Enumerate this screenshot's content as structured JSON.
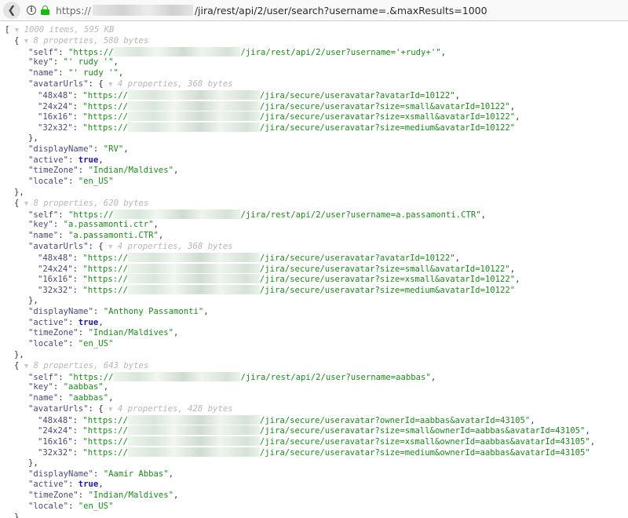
{
  "browser": {
    "url_prefix": "https://",
    "url_path": "/jira/rest/api/2/user/search?username=.&maxResults=1000"
  },
  "root": {
    "open": "[",
    "meta": "1000 items, 595 KB"
  },
  "users": [
    {
      "meta": "8 properties, 580 bytes",
      "self_prefix": "\"https://",
      "self_suffix": "/jira/rest/api/2/user?username='+rudy+'\"",
      "key": "\"' rudy '\"",
      "name": "\"' rudy '\"",
      "avatar_meta": "4 properties, 368 bytes",
      "avatars": [
        {
          "size": "\"48x48\"",
          "prefix": "\"https://",
          "suffix": "/jira/secure/useravatar?avatarId=10122\"",
          "comma": ","
        },
        {
          "size": "\"24x24\"",
          "prefix": "\"https://",
          "suffix": "/jira/secure/useravatar?size=small&avatarId=10122\"",
          "comma": ","
        },
        {
          "size": "\"16x16\"",
          "prefix": "\"https://",
          "suffix": "/jira/secure/useravatar?size=xsmall&avatarId=10122\"",
          "comma": ","
        },
        {
          "size": "\"32x32\"",
          "prefix": "\"https://",
          "suffix": "/jira/secure/useravatar?size=medium&avatarId=10122\"",
          "comma": ""
        }
      ],
      "displayName": "\"RV\"",
      "active": "true",
      "timeZone": "\"Indian/Maldives\"",
      "locale": "\"en_US\""
    },
    {
      "meta": "8 properties, 620 bytes",
      "self_prefix": "\"https://",
      "self_suffix": "/jira/rest/api/2/user?username=a.passamonti.CTR\"",
      "key": "\"a.passamonti.ctr\"",
      "name": "\"a.passamonti.CTR\"",
      "avatar_meta": "4 properties, 368 bytes",
      "avatars": [
        {
          "size": "\"48x48\"",
          "prefix": "\"https://",
          "suffix": "/jira/secure/useravatar?avatarId=10122\"",
          "comma": ","
        },
        {
          "size": "\"24x24\"",
          "prefix": "\"https://",
          "suffix": "/jira/secure/useravatar?size=small&avatarId=10122\"",
          "comma": ","
        },
        {
          "size": "\"16x16\"",
          "prefix": "\"https://",
          "suffix": "/jira/secure/useravatar?size=xsmall&avatarId=10122\"",
          "comma": ","
        },
        {
          "size": "\"32x32\"",
          "prefix": "\"https://",
          "suffix": "/jira/secure/useravatar?size=medium&avatarId=10122\"",
          "comma": ""
        }
      ],
      "displayName": "\"Anthony Passamonti\"",
      "active": "true",
      "timeZone": "\"Indian/Maldives\"",
      "locale": "\"en_US\""
    },
    {
      "meta": "8 properties, 643 bytes",
      "self_prefix": "\"https://",
      "self_suffix": "/jira/rest/api/2/user?username=aabbas\"",
      "key": "\"aabbas\"",
      "name": "\"aabbas\"",
      "avatar_meta": "4 properties, 428 bytes",
      "avatars": [
        {
          "size": "\"48x48\"",
          "prefix": "\"https://",
          "suffix": "/jira/secure/useravatar?ownerId=aabbas&avatarId=43105\"",
          "comma": ","
        },
        {
          "size": "\"24x24\"",
          "prefix": "\"https://",
          "suffix": "/jira/secure/useravatar?size=small&ownerId=aabbas&avatarId=43105\"",
          "comma": ","
        },
        {
          "size": "\"16x16\"",
          "prefix": "\"https://",
          "suffix": "/jira/secure/useravatar?size=xsmall&ownerId=aabbas&avatarId=43105\"",
          "comma": ","
        },
        {
          "size": "\"32x32\"",
          "prefix": "\"https://",
          "suffix": "/jira/secure/useravatar?size=medium&ownerId=aabbas&avatarId=43105\"",
          "comma": ""
        }
      ],
      "displayName": "\"Aamir Abbas\"",
      "active": "true",
      "timeZone": "\"Indian/Maldives\"",
      "locale": "\"en_US\""
    }
  ],
  "colors": {
    "string": "#1e8a1e",
    "boolean": "#1a1aa6",
    "secure_lock": "#12bc00"
  }
}
